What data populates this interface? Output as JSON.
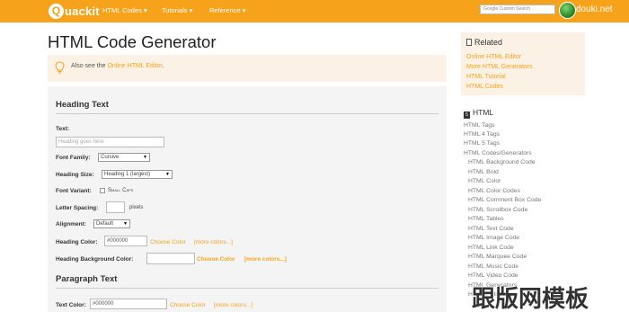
{
  "header": {
    "logo_letter": "Q",
    "logo_text": "uackit",
    "nav": [
      {
        "label": "HTML Codes ▾"
      },
      {
        "label": "Tutorials ▾"
      },
      {
        "label": "Reference ▾"
      }
    ],
    "search_placeholder": "Google Custom Search",
    "brand_right": "douki.net"
  },
  "main": {
    "title": "HTML Code Generator",
    "note": {
      "prefix": "Also see the ",
      "link": "Online HTML Editor",
      "suffix": "."
    },
    "heading_section": {
      "title": "Heading Text",
      "text_label": "Text:",
      "text_placeholder": "Heading goes here",
      "font_family_label": "Font Family:",
      "font_family_value": "Cursive",
      "heading_size_label": "Heading Size:",
      "heading_size_value": "Heading 1 (largest)",
      "font_variant_label": "Font Variant:",
      "font_variant_option": "Small Caps",
      "letter_spacing_label": "Letter Spacing:",
      "letter_spacing_unit": "pixels",
      "alignment_label": "Alignment:",
      "alignment_value": "Default",
      "heading_color_label": "Heading Color:",
      "heading_color_value": "#000000",
      "choose_color": "Choose Color",
      "more_colors": "[more colors...]",
      "heading_bg_label": "Heading Background Color:",
      "heading_bg_choose": "Choose Color",
      "heading_bg_more": "[more colors...]"
    },
    "paragraph_section": {
      "title": "Paragraph Text",
      "text_color_label": "Text Color:",
      "text_color_value": "#000000",
      "choose_color": "Choose Color",
      "more_colors": "[more colors...]"
    }
  },
  "sidebar": {
    "related": {
      "title": "Related",
      "links": [
        "Online HTML Editor",
        "More HTML Generators",
        "HTML Tutorial",
        "HTML Codes"
      ]
    },
    "html": {
      "title": "HTML",
      "items": [
        "HTML Tags",
        "HTML 4 Tags",
        "HTML 5 Tags",
        "HTML Codes/Generators"
      ],
      "sub_items": [
        "HTML Background Code",
        "HTML Bold",
        "HTML Color",
        "HTML Color Codes",
        "HTML Comment Box Code",
        "HTML Scrollbox Code",
        "HTML Tables",
        "HTML Text Code",
        "HTML Image Code",
        "HTML Link Code",
        "HTML Marquee Code",
        "HTML Music Code",
        "HTML Video Code",
        "HTML Generators",
        "HTML Entities"
      ]
    }
  },
  "watermark": "跟版网模板",
  "colors": {
    "accent": "#f6a21a",
    "panel": "#f4f4f4",
    "note_bg": "#fbf1e4"
  }
}
